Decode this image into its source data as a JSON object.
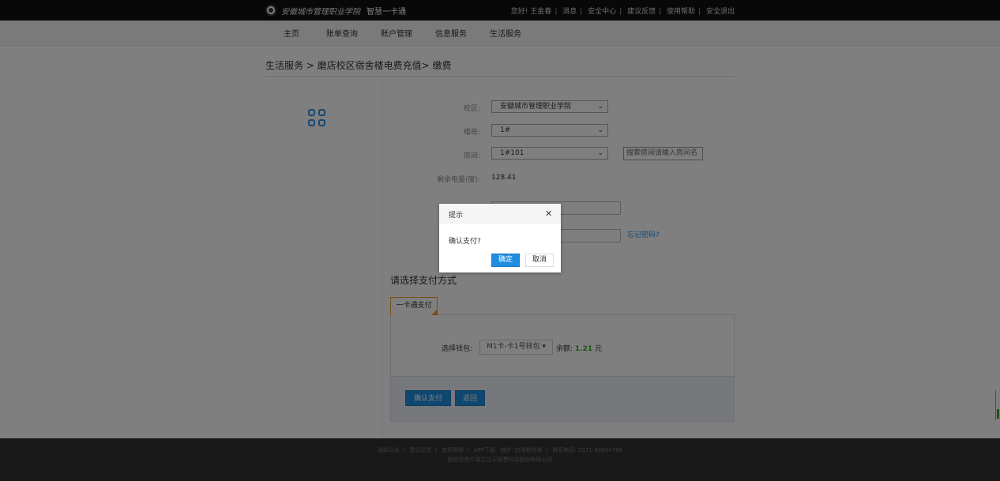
{
  "header": {
    "logo_script": "安徽城市管理职业学院",
    "logo_product": "智慧一卡通",
    "links": [
      "您好! 王金春",
      "消息",
      "安全中心",
      "建议反馈",
      "使用帮助",
      "安全退出"
    ]
  },
  "nav": {
    "items": [
      "主页",
      "账单查询",
      "账户管理",
      "信息服务",
      "生活服务"
    ]
  },
  "breadcrumb": "生活服务 > 磨店校区宿舍楼电费充值> 缴费",
  "form": {
    "campus_label": "校区:",
    "campus_value": "安徽城市管理职业学院",
    "building_label": "楼栋:",
    "building_value": "1#",
    "room_label": "房间:",
    "room_value": "1#101",
    "room_search_placeholder": "搜索房间请输入房间名",
    "remaining_label": "剩余电量(度):",
    "remaining_value": "128.41",
    "forgot_password": "忘记密码?"
  },
  "payment": {
    "title": "请选择支付方式",
    "tab": "一卡通支付",
    "wallet_label": "选择钱包:",
    "wallet_value": "M1卡-卡1号钱包",
    "balance_label": "余额:",
    "balance_value": "1.21",
    "balance_unit": "元",
    "confirm_button": "确认支付",
    "back_button": "返回"
  },
  "footer": {
    "links": [
      "通知公告",
      "建议反馈",
      "使用帮助",
      "APP下载"
    ],
    "maintain_label": "维护:",
    "maintain_value": "应用软件部",
    "contact_label": "联系电话:",
    "contact_value": "0571-88894788",
    "copyright": "版权所有©浙江正元智慧科技股份有限公司"
  },
  "dialog": {
    "title": "提示",
    "message": "确认支付?",
    "ok": "确定",
    "cancel": "取消"
  },
  "colors": {
    "accent": "#1f8ee0",
    "tab_border": "#f39b2d",
    "balance": "#3aa52c"
  }
}
